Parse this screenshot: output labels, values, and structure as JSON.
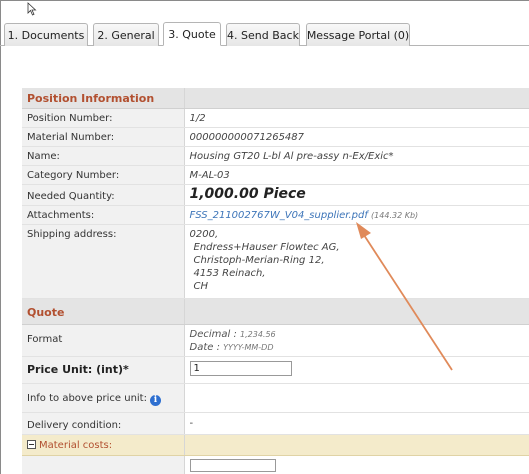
{
  "tabs": [
    {
      "label": "1. Documents",
      "active": false
    },
    {
      "label": "2. General",
      "active": false
    },
    {
      "label": "3. Quote",
      "active": true
    },
    {
      "label": "4. Send Back",
      "active": false
    },
    {
      "label": "Message Portal (0)",
      "active": false
    }
  ],
  "position_information": {
    "title": "Position Information",
    "position_number_label": "Position Number:",
    "position_number": "1/2",
    "material_number_label": "Material Number:",
    "material_number": "000000000071265487",
    "name_label": "Name:",
    "name": "Housing GT20 L-bl Al pre-assy n-Ex/Exic*",
    "category_number_label": "Category Number:",
    "category_number": "M-AL-03",
    "needed_quantity_label": "Needed Quantity:",
    "needed_quantity": "1,000.00 Piece",
    "attachments_label": "Attachments:",
    "attachment_file": "FSS_211002767W_V04_supplier.pdf",
    "attachment_size": "(144.32 Kb)",
    "shipping_address_label": "Shipping address:",
    "shipping_address": [
      "0200,",
      "Endress+Hauser Flowtec AG,",
      "Christoph-Merian-Ring 12,",
      "4153 Reinach,",
      "CH"
    ]
  },
  "quote": {
    "title": "Quote",
    "format_label": "Format",
    "decimal_label": "Decimal :",
    "decimal_example": "1,234.56",
    "date_label": "Date :",
    "date_example": "YYYY-MM-DD",
    "price_unit_label": "Price Unit: (int)*",
    "price_unit_value": "1",
    "info_price_unit_label": "Info to above price unit:",
    "info_icon_glyph": "i",
    "delivery_condition_label": "Delivery condition:",
    "delivery_condition_value": "-",
    "material_costs_label": "Material costs:",
    "material_costs_toggle_glyph": "−"
  },
  "colors": {
    "section_title": "#b25030",
    "link": "#3c74b8",
    "arrow": "#e08a5a",
    "highlight_row": "#f4ebcb",
    "info_icon": "#2e6fd0"
  }
}
